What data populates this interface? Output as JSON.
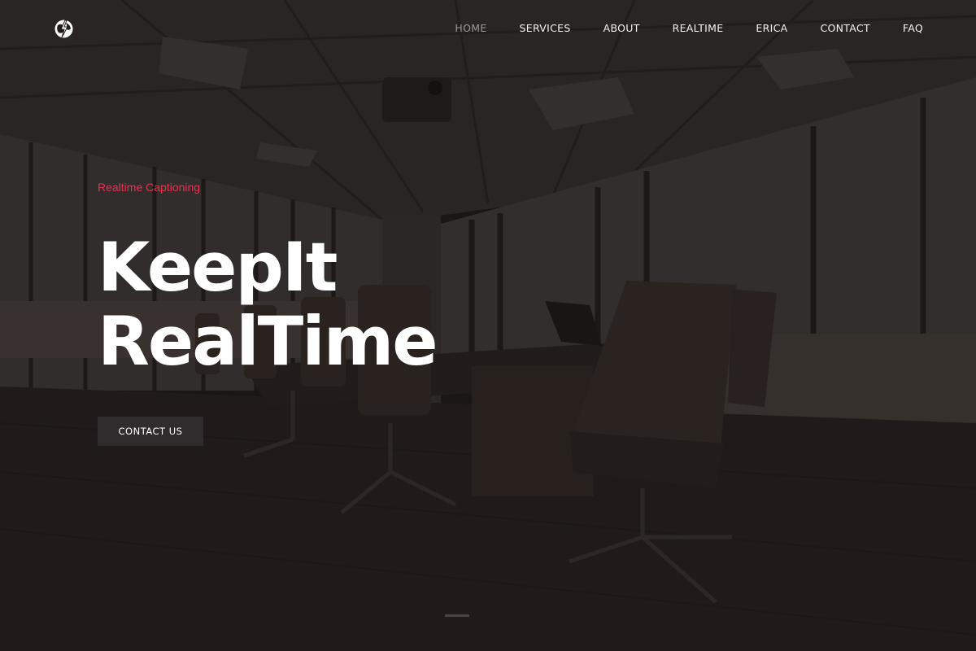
{
  "header": {
    "logo_icon": "globe-bolt-icon",
    "nav": [
      {
        "label": "HOME",
        "active": true
      },
      {
        "label": "SERVICES",
        "active": false
      },
      {
        "label": "ABOUT",
        "active": false
      },
      {
        "label": "REALTIME",
        "active": false
      },
      {
        "label": "ERICA",
        "active": false
      },
      {
        "label": "CONTACT",
        "active": false
      },
      {
        "label": "FAQ",
        "active": false
      }
    ]
  },
  "hero": {
    "eyebrow": "Realtime Captioning",
    "title_line1": "KeepIt",
    "title_line2": "RealTime",
    "cta_label": "CONTACT US"
  },
  "colors": {
    "accent": "#e0354f",
    "nav_active": "#9d9898",
    "button_bg": "#2e2c2d"
  }
}
